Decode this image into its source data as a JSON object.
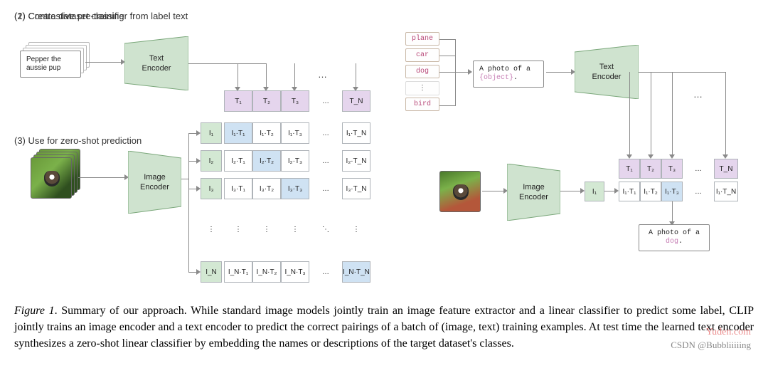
{
  "headings": {
    "h1": "(1) Contrastive pre-training",
    "h2": "(2) Create dataset classifier from label text",
    "h3": "(3) Use for zero-shot prediction"
  },
  "panel1": {
    "sample_text": "Pepper the aussie pup",
    "text_encoder": "Text\nEncoder",
    "image_encoder": "Image\nEncoder",
    "t_header": [
      "T₁",
      "T₂",
      "T₃",
      "…",
      "T_N"
    ],
    "i_header": [
      "I₁",
      "I₂",
      "I₃",
      "⋮",
      "I_N"
    ],
    "matrix": [
      [
        "I₁·T₁",
        "I₁·T₂",
        "I₁·T₃",
        "…",
        "I₁·T_N"
      ],
      [
        "I₂·T₁",
        "I₂·T₂",
        "I₂·T₃",
        "…",
        "I₂·T_N"
      ],
      [
        "I₃·T₁",
        "I₃·T₂",
        "I₃·T₃",
        "…",
        "I₃·T_N"
      ],
      [
        "⋮",
        "⋮",
        "⋮",
        "⋱",
        "⋮"
      ],
      [
        "I_N·T₁",
        "I_N·T₂",
        "I_N·T₃",
        "…",
        "I_N·T_N"
      ]
    ]
  },
  "panel2": {
    "labels": [
      "plane",
      "car",
      "dog",
      "⋮",
      "bird"
    ],
    "prompt_prefix": "A photo of a ",
    "prompt_obj": "{object}",
    "prompt_suffix": ".",
    "text_encoder": "Text\nEncoder"
  },
  "panel3": {
    "image_encoder": "Image\nEncoder",
    "I1": "I₁",
    "t_header": [
      "T₁",
      "T₂",
      "T₃",
      "…",
      "T_N"
    ],
    "row": [
      "I₁·T₁",
      "I₁·T₂",
      "I₁·T₃",
      "…",
      "I₁·T_N"
    ],
    "result_prefix": "A photo of a ",
    "result_obj": "dog",
    "result_suffix": "."
  },
  "caption": {
    "label": "Figure 1",
    "text": ". Summary of our approach. While standard image models jointly train an image feature extractor and a linear classifier to predict some label, CLIP jointly trains an image encoder and a text encoder to predict the correct pairings of a batch of (image, text) training examples. At test time the learned text encoder synthesizes a zero-shot linear classifier by embedding the names or descriptions of the target dataset's classes."
  },
  "watermarks": {
    "w1": "Yuden.com",
    "w2": "CSDN @Bubbliiiiing"
  }
}
